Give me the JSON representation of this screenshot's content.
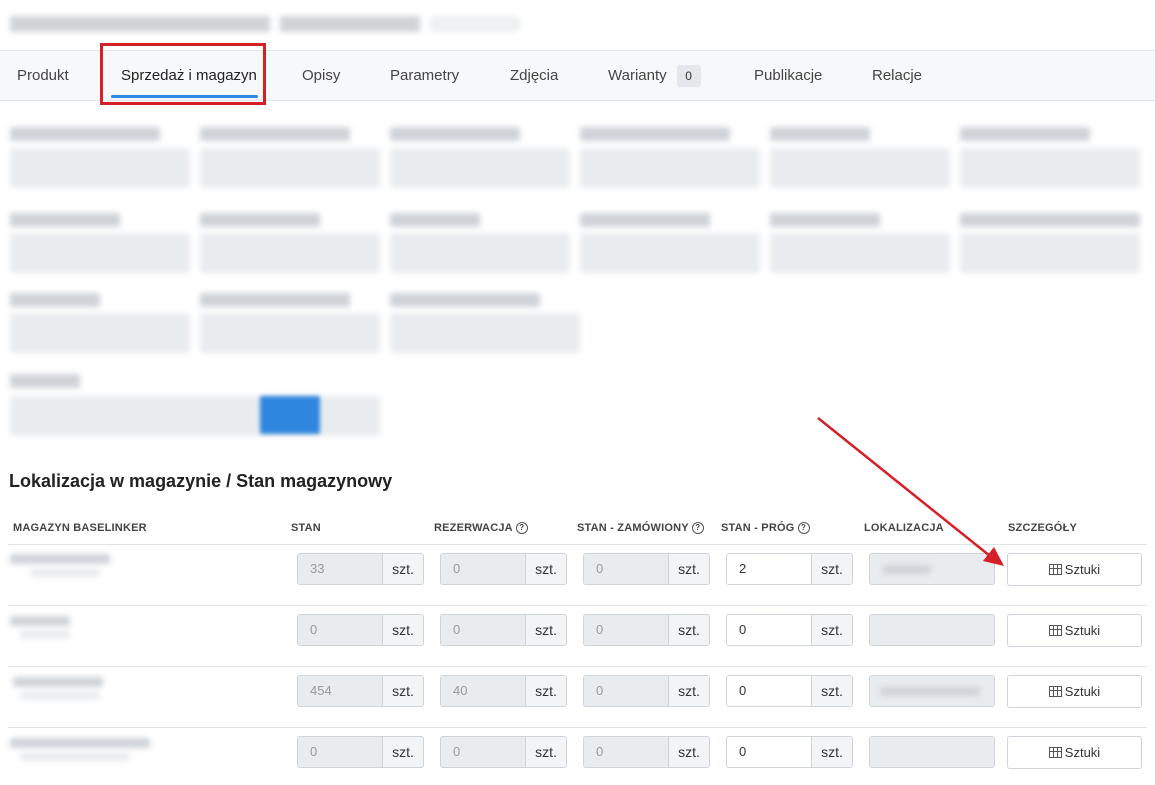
{
  "tabs": [
    {
      "label": "Produkt"
    },
    {
      "label": "Sprzedaż i magazyn"
    },
    {
      "label": "Opisy"
    },
    {
      "label": "Parametry"
    },
    {
      "label": "Zdjęcia"
    },
    {
      "label": "Warianty",
      "badge": "0"
    },
    {
      "label": "Publikacje"
    },
    {
      "label": "Relacje"
    }
  ],
  "active_tab": "Sprzedaż i magazyn",
  "annotation": {
    "highlight_color": "#d62027",
    "arrow_color": "#d62027"
  },
  "stock": {
    "title": "Lokalizacja w magazynie / Stan magazynowy",
    "headers": {
      "warehouse": "MAGAZYN BASELINKER",
      "stan": "STAN",
      "rezerwacja": "REZERWACJA",
      "zamowiony": "STAN - ZAMÓWIONY",
      "prog": "STAN - PRÓG",
      "lokalizacja": "LOKALIZACJA",
      "szczegoly": "SZCZEGÓŁY"
    },
    "unit": "szt.",
    "details_label": "Sztuki",
    "rows": [
      {
        "stan": "33",
        "rezerwacja": "0",
        "zamowiony": "0",
        "prog": "2"
      },
      {
        "stan": "0",
        "rezerwacja": "0",
        "zamowiony": "0",
        "prog": "0"
      },
      {
        "stan": "454",
        "rezerwacja": "40",
        "zamowiony": "0",
        "prog": "0"
      },
      {
        "stan": "0",
        "rezerwacja": "0",
        "zamowiony": "0",
        "prog": "0"
      }
    ]
  }
}
